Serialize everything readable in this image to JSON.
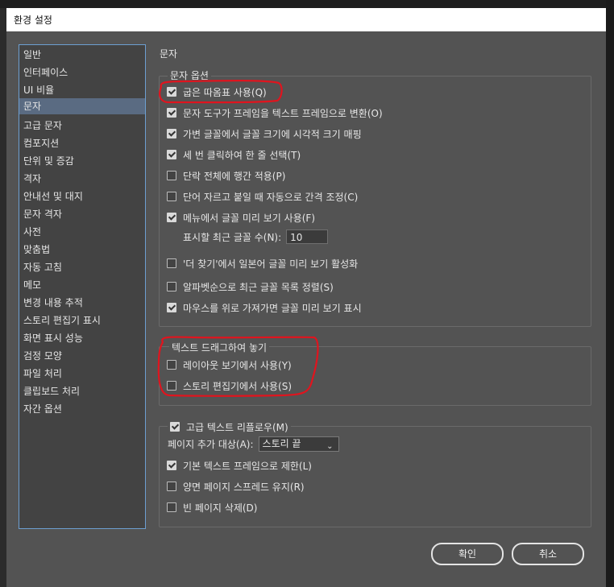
{
  "window": {
    "title": "환경 설정"
  },
  "categories": [
    {
      "label": "일반"
    },
    {
      "label": "인터페이스"
    },
    {
      "label": "UI 비율"
    },
    {
      "label": "문자"
    },
    {
      "label": "고급 문자"
    },
    {
      "label": "컴포지션"
    },
    {
      "label": "단위 및 증감"
    },
    {
      "label": "격자"
    },
    {
      "label": "안내선 및 대지"
    },
    {
      "label": "문자 격자"
    },
    {
      "label": "사전"
    },
    {
      "label": "맞춤법"
    },
    {
      "label": "자동 고침"
    },
    {
      "label": "메모"
    },
    {
      "label": "변경 내용 추적"
    },
    {
      "label": "스토리 편집기 표시"
    },
    {
      "label": "화면 표시 성능"
    },
    {
      "label": "검정 모양"
    },
    {
      "label": "파일 처리"
    },
    {
      "label": "클립보드 처리"
    },
    {
      "label": "자간 옵션"
    }
  ],
  "selected_category": "문자",
  "section_title": "문자",
  "type_options": {
    "label": "문자 옵션",
    "items": [
      {
        "label": "굽은 따옴표 사용(Q)",
        "checked": true
      },
      {
        "label": "문자 도구가 프레임을 텍스트 프레임으로 변환(O)",
        "checked": true
      },
      {
        "label": "가변 글꼴에서 글꼴 크기에 시각적 크기 매핑",
        "checked": true
      },
      {
        "label": "세 번 클릭하여 한 줄 선택(T)",
        "checked": true
      },
      {
        "label": "단락 전체에 행간 적용(P)",
        "checked": false
      },
      {
        "label": "단어 자르고 붙일 때 자동으로 간격 조정(C)",
        "checked": false
      },
      {
        "label": "메뉴에서 글꼴 미리 보기 사용(F)",
        "checked": true
      }
    ],
    "recent_fonts_label": "표시할 최근 글꼴 수(N):",
    "recent_fonts_value": "10",
    "items2": [
      {
        "label": "'더 찾기'에서 일본어 글꼴 미리 보기 활성화",
        "checked": false
      },
      {
        "label": "알파벳순으로 최근 글꼴 목록 정렬(S)",
        "checked": false
      },
      {
        "label": "마우스를 위로 가져가면 글꼴 미리 보기 표시",
        "checked": true
      }
    ]
  },
  "drag_drop": {
    "label": "텍스트 드래그하여 놓기",
    "items": [
      {
        "label": "레이아웃 보기에서 사용(Y)",
        "checked": false
      },
      {
        "label": "스토리 편집기에서 사용(S)",
        "checked": false
      }
    ]
  },
  "smart_reflow": {
    "label": "고급 텍스트 리플로우(M)",
    "checked": true,
    "add_pages_label": "페이지 추가 대상(A):",
    "add_pages_value": "스토리 끝",
    "items": [
      {
        "label": "기본 텍스트 프레임으로 제한(L)",
        "checked": true
      },
      {
        "label": "양면 페이지 스프레드 유지(R)",
        "checked": false
      },
      {
        "label": "빈 페이지 삭제(D)",
        "checked": false
      }
    ]
  },
  "buttons": {
    "ok": "확인",
    "cancel": "취소"
  },
  "annotation_color": "#e0141e"
}
